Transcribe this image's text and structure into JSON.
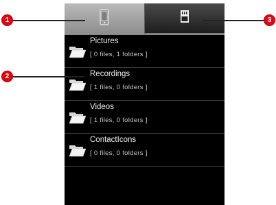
{
  "tabs": [
    {
      "icon": "phone-icon",
      "selected": true
    },
    {
      "icon": "sd-card-icon",
      "selected": false
    }
  ],
  "folders": [
    {
      "name": "Pictures",
      "meta": "[ 0 files, 1 folders  ]"
    },
    {
      "name": "Recordings",
      "meta": "[ 1 files, 0 folders  ]"
    },
    {
      "name": "Videos",
      "meta": "[ 1 files, 0 folders  ]"
    },
    {
      "name": "ContactIcons",
      "meta": "[ 0 files, 0 folders  ]"
    }
  ],
  "callouts": [
    "1",
    "2",
    "3"
  ],
  "colors": {
    "callout": "#e30613",
    "background": "#000000"
  }
}
